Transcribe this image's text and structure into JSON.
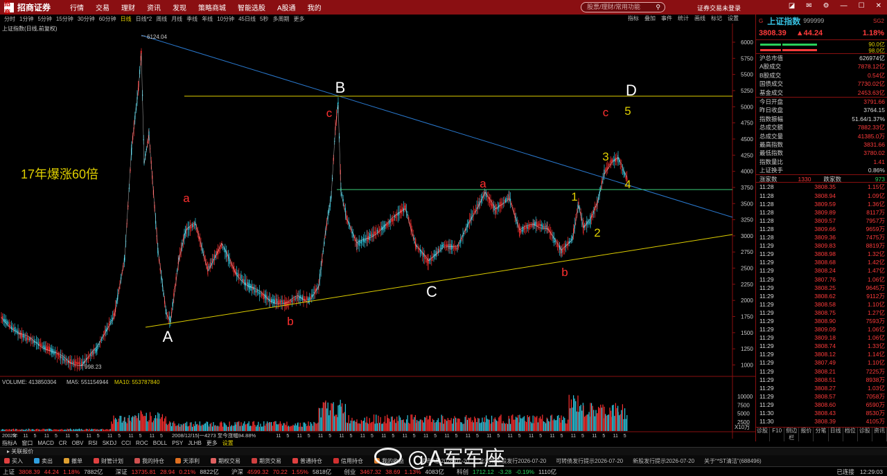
{
  "app": {
    "logo": "招商证券",
    "logo_mark": "招商"
  },
  "menu": [
    "行情",
    "交易",
    "理财",
    "资讯",
    "发现",
    "策略商城",
    "智能选股",
    "A股通",
    "我的"
  ],
  "search_placeholder": "股票/理财/常用功能",
  "login_text": "证券交易未登录",
  "periods": [
    "分时",
    "1分钟",
    "5分钟",
    "15分钟",
    "30分钟",
    "60分钟",
    "日线",
    "日线*2",
    "周线",
    "月线",
    "季线",
    "年线",
    "10分钟",
    "45日线",
    "5秒",
    "多周期",
    "更多"
  ],
  "active_period": "日线",
  "tools": [
    "指标",
    "叠加",
    "事件",
    "统计",
    "画线",
    "标记",
    "设置"
  ],
  "chart": {
    "name": "上证指数(日线,前复权)",
    "y_ticks": [
      "6000",
      "5750",
      "5500",
      "5250",
      "5000",
      "4750",
      "4500",
      "4250",
      "4000",
      "3750",
      "3500",
      "3250",
      "3000",
      "2750",
      "2500",
      "2250",
      "2000",
      "1750",
      "1500",
      "1250",
      "1000"
    ],
    "x_labels": [
      "2002年",
      "5",
      "11",
      "5",
      "11",
      "5",
      "11",
      "5",
      "11",
      "5",
      "11",
      "5",
      "11",
      "5",
      "11",
      "5",
      "11",
      "5",
      "11",
      "5",
      "11",
      "5",
      "11",
      "5",
      "11",
      "5",
      "11",
      "5",
      "11",
      "5",
      "11",
      "5",
      "11",
      "5",
      "11",
      "5",
      "11",
      "5",
      "11",
      "5",
      "11",
      "5",
      "11",
      "5",
      "11",
      "5",
      "11",
      "5",
      "11",
      "5",
      "11",
      "5",
      "11",
      "5",
      "11",
      "5",
      "11",
      "5",
      "11",
      "5"
    ],
    "range_text": "2008/12/15|一4273 至今涨幅94.88%",
    "high_label": "6124.04",
    "low_label": "998.23",
    "annotation": "17年爆涨60倍",
    "wave_labels": {
      "A": "A",
      "B": "B",
      "C": "C",
      "D": "D",
      "a1": "a",
      "b1": "b",
      "c1": "c",
      "a2": "a",
      "b2": "b",
      "c2": "c",
      "w1": "1",
      "w2": "2",
      "w3": "3",
      "w4": "4",
      "w5": "5"
    },
    "volume_legend": {
      "vol": "VOLUME: 413850304",
      "ma5": "MA5: 551154944",
      "ma10": "MA10: 553787840"
    },
    "vol_ticks": [
      "10000",
      "7500",
      "5000",
      "2500"
    ],
    "vol_unit": "X10万",
    "colors": {
      "up": "#ff3030",
      "down": "#30c8e0",
      "ma": "#ffffff",
      "trend": "#e0d000",
      "blue": "#2a7ad0",
      "green": "#3ad07a"
    }
  },
  "indicators": [
    "指标A",
    "窗口",
    "MACD",
    "CR",
    "OBV",
    "RSI",
    "SKDJ",
    "CCI",
    "ROC",
    "BOLL",
    "PSY",
    "JLHB",
    "更多",
    "设置"
  ],
  "quote": {
    "g": "G",
    "name": "上证指数",
    "code": "999999",
    "sg": "SG2",
    "price": "3808.39",
    "change": "▲44.24",
    "pct": "1.18%",
    "bar1": "90.0亿",
    "bar2": "98.0亿",
    "rows1": [
      [
        "沪总市值",
        "626974亿",
        ""
      ],
      [
        "A股成交",
        "7878.12亿",
        "red"
      ],
      [
        "B股成交",
        "0.54亿",
        "red"
      ],
      [
        "国债成交",
        "7730.02亿",
        "red"
      ],
      [
        "基金成交",
        "2453.63亿",
        "red"
      ]
    ],
    "rows2": [
      [
        "今日开盘",
        "3791.66",
        "red"
      ],
      [
        "昨日收盘",
        "3764.15",
        ""
      ],
      [
        "指数振幅",
        "51.64/1.37%",
        ""
      ],
      [
        "总成交额",
        "7882.33亿",
        "red"
      ],
      [
        "总成交量",
        "41385.0万",
        "red"
      ],
      [
        "最高指数",
        "3831.66",
        "red"
      ],
      [
        "最低指数",
        "3780.02",
        "red"
      ],
      [
        "指数量比",
        "1.41",
        "red"
      ],
      [
        "上证换手",
        "0.86%",
        ""
      ]
    ],
    "zhang": {
      "up_label": "涨家数",
      "up": "1330",
      "down_label": "跌家数",
      "down": "973"
    },
    "ticks": [
      [
        "11:28",
        "3808.35",
        "1.15亿"
      ],
      [
        "11:28",
        "3808.94",
        "1.09亿"
      ],
      [
        "11:28",
        "3809.59",
        "1.36亿"
      ],
      [
        "11:28",
        "3809.89",
        "8117万"
      ],
      [
        "11:28",
        "3809.57",
        "7957万"
      ],
      [
        "11:28",
        "3809.66",
        "9659万"
      ],
      [
        "11:28",
        "3809.36",
        "7475万"
      ],
      [
        "11:29",
        "3809.83",
        "8819万"
      ],
      [
        "11:29",
        "3808.98",
        "1.32亿"
      ],
      [
        "11:29",
        "3808.68",
        "1.42亿"
      ],
      [
        "11:29",
        "3808.24",
        "1.47亿"
      ],
      [
        "11:29",
        "3807.76",
        "1.06亿"
      ],
      [
        "11:29",
        "3808.25",
        "9645万"
      ],
      [
        "11:29",
        "3808.62",
        "9112万"
      ],
      [
        "11:29",
        "3808.58",
        "1.10亿"
      ],
      [
        "11:29",
        "3808.75",
        "1.27亿"
      ],
      [
        "11:29",
        "3808.90",
        "7593万"
      ],
      [
        "11:29",
        "3809.09",
        "1.06亿"
      ],
      [
        "11:29",
        "3809.18",
        "1.06亿"
      ],
      [
        "11:29",
        "3808.74",
        "1.33亿"
      ],
      [
        "11:29",
        "3808.12",
        "1.14亿"
      ],
      [
        "11:29",
        "3807.49",
        "1.10亿"
      ],
      [
        "11:29",
        "3808.21",
        "7225万"
      ],
      [
        "11:29",
        "3808.51",
        "8938万"
      ],
      [
        "11:29",
        "3808.27",
        "1.03亿"
      ],
      [
        "11:29",
        "3808.57",
        "7058万"
      ],
      [
        "11:29",
        "3808.60",
        "6590万"
      ],
      [
        "11:30",
        "3808.43",
        "8530万"
      ],
      [
        "11:30",
        "3808.39",
        "4105万"
      ]
    ],
    "tabs": [
      "诊股",
      "F10",
      "侧边栏",
      "报价",
      "分笔",
      "日线",
      "档位",
      "诊股",
      "资讯"
    ]
  },
  "related": "关联报价",
  "toolbar": [
    "买入",
    "卖出",
    "撤单",
    "财管计划",
    "我的持仓",
    "天添利",
    "期权交易",
    "期货交易",
    "普通持仓",
    "信用持仓",
    "我的收益"
  ],
  "news": [
    "沪市A股2026-07-20",
    "北交所新股发行2026-07-20",
    "可转债发行提示2026-07-20",
    "新股发行提示2026-07-20",
    "关于“*ST清洁”(688496)"
  ],
  "status": [
    {
      "name": "上证",
      "price": "3808.39",
      "chg": "44.24",
      "pct": "1.18%",
      "amt": "7882亿"
    },
    {
      "name": "深证",
      "price": "13735.81",
      "chg": "28.94",
      "pct": "0.21%",
      "amt": "8822亿"
    },
    {
      "name": "沪深",
      "price": "4599.32",
      "chg": "70.22",
      "pct": "1.55%",
      "amt": "5818亿"
    },
    {
      "name": "创业",
      "price": "3467.32",
      "chg": "38.69",
      "pct": "1.13%",
      "amt": "4083亿"
    },
    {
      "name": "科创",
      "price": "1712.12",
      "chg": "-3.28",
      "pct": "-0.19%",
      "amt": "1110亿"
    }
  ],
  "status_right": {
    "ready": "已连接",
    "time": "12:29:03"
  },
  "watermark": "@A军军座"
}
